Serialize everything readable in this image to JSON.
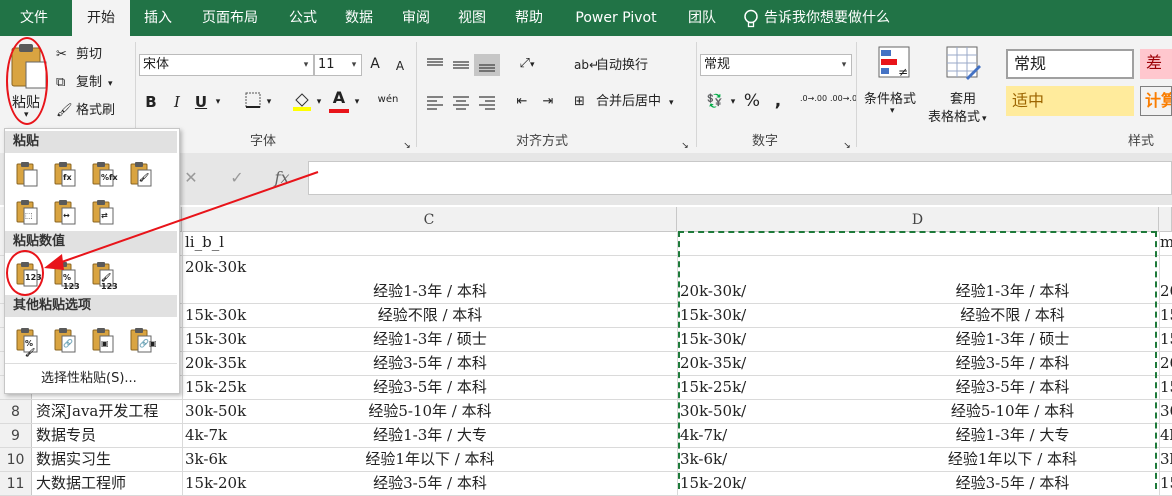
{
  "tabs": [
    "文件",
    "开始",
    "插入",
    "页面布局",
    "公式",
    "数据",
    "审阅",
    "视图",
    "帮助",
    "Power Pivot",
    "团队"
  ],
  "tell_me": "告诉我你想要做什么",
  "clipboard": {
    "paste_label": "粘贴",
    "cut": "剪切",
    "copy": "复制",
    "format_painter": "格式刷"
  },
  "font": {
    "family": "宋体",
    "size": "11",
    "group_label": "字体",
    "bold": "B",
    "italic": "I",
    "underline": "U",
    "grow": "A",
    "shrink": "A",
    "phonetic": "wén"
  },
  "alignment": {
    "wrap": "自动换行",
    "merge": "合并后居中",
    "group_label": "对齐方式"
  },
  "number": {
    "format": "常规",
    "group_label": "数字",
    "percent": "%",
    "comma": ",",
    "inc_decimal": ".0→.00",
    "dec_decimal": ".00→.0"
  },
  "styles": {
    "cond_format": "条件格式",
    "table_format_1": "套用",
    "table_format_2": "表格格式",
    "group_label": "样式",
    "style_normal": "常规",
    "style_bad": "差",
    "style_neutral": "适中",
    "style_calc": "计算"
  },
  "formula_bar": {
    "fx": "fx",
    "cancel": "✕",
    "enter": "✓"
  },
  "columns": [
    "C",
    "D"
  ],
  "paste_menu": {
    "section_paste": "粘贴",
    "section_values": "粘贴数值",
    "section_other": "其他粘贴选项",
    "paste_special": "选择性粘贴(S)...",
    "badge_123": "123",
    "badge_pct": "%",
    "badge_fx": "fx"
  },
  "rows": [
    {
      "num": "",
      "b": "",
      "c1": "li_b_l",
      "c2": "",
      "d1": "",
      "d2": "",
      "e": "me"
    },
    {
      "num": "",
      "b": "",
      "c1": "20k-30k",
      "c2": "经验1-3年 / 本科",
      "d1": "20k-30k/",
      "d2": "经验1-3年 / 本科",
      "e": "20"
    },
    {
      "num": "",
      "b": "",
      "c1": "15k-30k",
      "c2": "经验不限 / 本科",
      "d1": "15k-30k/",
      "d2": "经验不限 / 本科",
      "e": "15"
    },
    {
      "num": "",
      "b": "",
      "c1": "15k-30k",
      "c2": "经验1-3年 / 硕士",
      "d1": "15k-30k/",
      "d2": "经验1-3年 / 硕士",
      "e": "15"
    },
    {
      "num": "",
      "b": "",
      "c1": "20k-35k",
      "c2": "经验3-5年 / 本科",
      "d1": "20k-35k/",
      "d2": "经验3-5年 / 本科",
      "e": "20"
    },
    {
      "num": "",
      "b": "",
      "c1": "15k-25k",
      "c2": "经验3-5年 / 本科",
      "d1": "15k-25k/",
      "d2": "经验3-5年 / 本科",
      "e": "15"
    },
    {
      "num": "8",
      "b": "资深Java开发工程",
      "c1": "30k-50k",
      "c2": "经验5-10年 / 本科",
      "d1": "30k-50k/",
      "d2": "经验5-10年 / 本科",
      "e": "30"
    },
    {
      "num": "9",
      "b": "数据专员",
      "c1": "4k-7k",
      "c2": "经验1-3年 / 大专",
      "d1": "4k-7k/",
      "d2": "经验1-3年 / 大专",
      "e": "4k"
    },
    {
      "num": "10",
      "b": "数据实习生",
      "c1": "3k-6k",
      "c2": "经验1年以下 / 本科",
      "d1": "3k-6k/",
      "d2": "经验1年以下 / 本科",
      "e": "3k"
    },
    {
      "num": "11",
      "b": "大数据工程师",
      "c1": "15k-20k",
      "c2": "经验3-5年 / 本科",
      "d1": "15k-20k/",
      "d2": "经验3-5年 / 本科",
      "e": "15"
    }
  ],
  "colors": {
    "excel_green": "#217346",
    "annotation_red": "#e8141a",
    "marquee": "#1e7a3a"
  }
}
